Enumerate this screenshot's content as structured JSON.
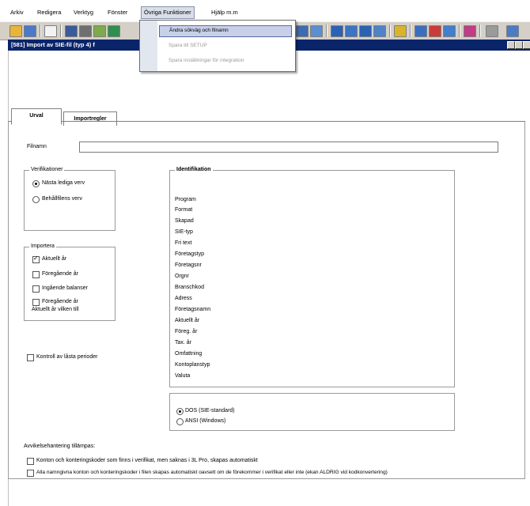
{
  "menubar": {
    "items": [
      "Arkiv",
      "Redigera",
      "Verktyg",
      "Fönster",
      "Övriga Funktioner",
      "Hjälp m.m"
    ]
  },
  "dropdown": {
    "items": [
      {
        "label": "Ändra sökväg och filnamn",
        "disabled": false
      },
      {
        "label": "Spara till SETUP",
        "disabled": true
      },
      {
        "label": "Spara inställningar för integration",
        "disabled": true
      }
    ]
  },
  "window": {
    "title": "[581] Import av SIE-fil (typ 4) f"
  },
  "tabs": [
    "Urval",
    "Importregler"
  ],
  "form": {
    "filename_label": "Filnamn",
    "filename_value": "",
    "verifikationer": {
      "title": "Verifikationer",
      "options": [
        {
          "label": "Nästa lediga verv",
          "selected": true
        },
        {
          "label": "Behållfilens verv",
          "selected": false
        }
      ]
    },
    "importera": {
      "title": "Importera",
      "options": [
        {
          "label": "Aktuellt år",
          "checked": true
        },
        {
          "label": "Föregående år",
          "checked": false
        },
        {
          "label": "Ingående balanser",
          "checked": false
        },
        {
          "label": "Föregående år",
          "sublabel": "Aktuellt år vilken till",
          "checked": false
        }
      ]
    },
    "kontroll_label": "Kontroll av låsta perioder",
    "kontroll_checked": false,
    "identifikation": {
      "title": "Identifikation",
      "fields": [
        "Program",
        "Format",
        "Skapad",
        "SIE-typ",
        "Fri text",
        "Företagstyp",
        "Företagsnr",
        "Orgnr",
        "Branschkod",
        "Adress",
        "Företagsnamn",
        "Aktuellt år",
        "Föreg. år",
        "Tax. år",
        "Omfattning",
        "Kontoplanstyp",
        "Valuta"
      ]
    },
    "charset": {
      "options": [
        {
          "label": "DOS (SIE-standard)",
          "selected": true
        },
        {
          "label": "ANSI (Windows)",
          "selected": false
        }
      ]
    },
    "avvikelse": {
      "title": "Avvikelsehantering tillämpas:",
      "options": [
        {
          "label": "Konton och konteringskoder som finns i verifikat, men saknas i 3L Pro, skapas automatiskt",
          "checked": false
        },
        {
          "label": "Alla namngivna konton och konteringskoder i filen skapas automatiskt oavsett om de förekommer i verifikat eller inte (ekan ALDRIG vid kodkonvertering)",
          "checked": false
        }
      ]
    }
  },
  "colors": {
    "titlebar": "#0a246a",
    "toolbar": "#d4d0c8",
    "menu_highlight": "#c7d0e8"
  }
}
